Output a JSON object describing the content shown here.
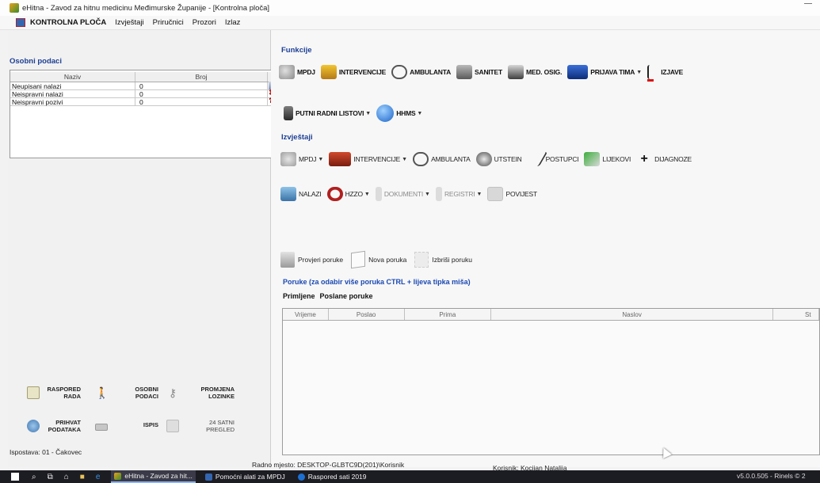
{
  "window": {
    "title": "eHitna - Zavod za hitnu medicinu Međimurske Županije - [Kontrolna ploča]"
  },
  "menu": {
    "items": [
      "KONTROLNA PLOČA",
      "Izvještaji",
      "Priručnici",
      "Prozori",
      "Izlaz"
    ]
  },
  "left": {
    "section_title": "Osobni podaci",
    "grid": {
      "columns": [
        "Naziv",
        "Broj"
      ],
      "rows": [
        {
          "naziv": "Neupisani nalazi",
          "broj": "0"
        },
        {
          "naziv": "Neispravni nalazi",
          "broj": "0"
        },
        {
          "naziv": "Neispravni pozivi",
          "broj": "0"
        }
      ]
    },
    "buttons": {
      "raspored": "RASPORED RADA",
      "osobni": "OSOBNI PODACI",
      "promjena": "PROMJENA LOZINKE",
      "prihvat": "PRIHVAT PODATAKA",
      "ispis": "ISPIS",
      "satni": "24 SATNI PREGLED"
    },
    "status": "Ispostava: 01 - Čakovec"
  },
  "funkcije": {
    "title": "Funkcije",
    "row1": [
      "MPDJ",
      "INTERVENCIJE",
      "AMBULANTA",
      "SANITET",
      "MED. OSIG.",
      "PRIJAVA TIMA",
      "IZJAVE"
    ],
    "row2": [
      "PUTNI RADNI LISTOVI",
      "HHMS"
    ]
  },
  "izvjestaji": {
    "title": "Izvještaji",
    "row1": [
      "MPDJ",
      "INTERVENCIJE",
      "AMBULANTA",
      "UTSTEIN",
      "POSTUPCI",
      "LIJEKOVI",
      "DIJAGNOZE"
    ],
    "row2": [
      "NALAZI",
      "HZZO",
      "DOKUMENTI",
      "REGISTRI",
      "POVIJEST"
    ]
  },
  "poruke": {
    "actions": [
      "Provjeri poruke",
      "Nova poruka",
      "Izbriši poruku"
    ],
    "title": "Poruke (za odabir više poruka CTRL + lijeva tipka miša)",
    "tabs": [
      "Primljene",
      "Poslane poruke"
    ],
    "columns": [
      "Vrijeme",
      "Poslao",
      "Prima",
      "Naslov",
      "St"
    ]
  },
  "statusbar": {
    "radno_mjesto": "Radno mjesto: DESKTOP-GLBTC9D(201)\\Korisnik",
    "korisnik": "Korisnik: Kocijan Natalija",
    "version": "v5.0.0.505 - Rinels © 2"
  },
  "taskbar": {
    "apps": [
      "eHitna - Zavod za hit...",
      "Pomoćni alati za MPDJ",
      "Raspored sati 2019"
    ]
  },
  "colors": {
    "section_title": "#1c3f94",
    "messages_title": "#1b49b3",
    "taskbar": "#1c1c23"
  }
}
